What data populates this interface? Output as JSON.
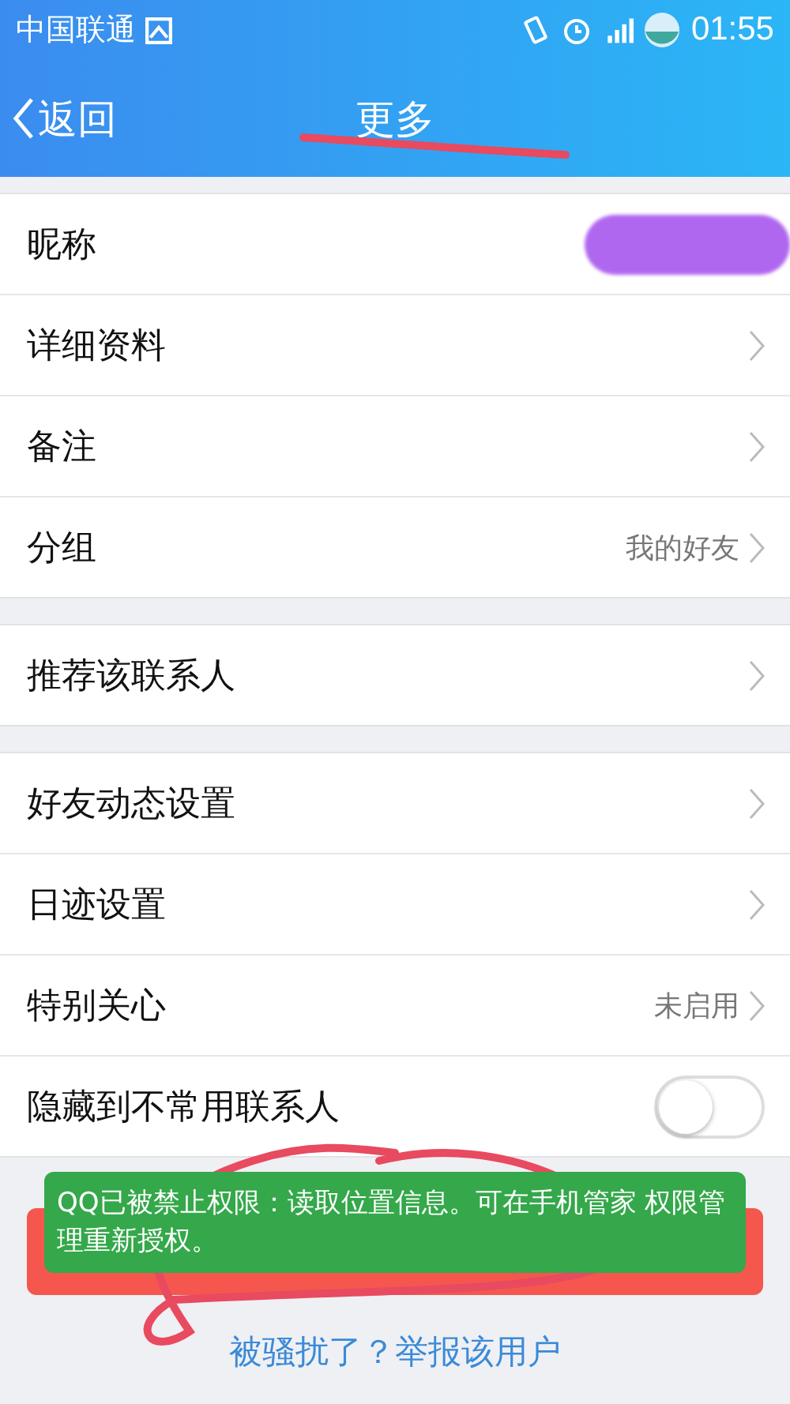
{
  "status_bar": {
    "carrier": "中国联通",
    "time": "01:55"
  },
  "nav": {
    "back": "返回",
    "title": "更多"
  },
  "sections": [
    [
      {
        "kind": "redacted",
        "label": "昵称"
      },
      {
        "kind": "link",
        "label": "详细资料"
      },
      {
        "kind": "link",
        "label": "备注"
      },
      {
        "kind": "link",
        "label": "分组",
        "value": "我的好友"
      }
    ],
    [
      {
        "kind": "link",
        "label": "推荐该联系人"
      }
    ],
    [
      {
        "kind": "link",
        "label": "好友动态设置"
      },
      {
        "kind": "link",
        "label": "日迹设置"
      },
      {
        "kind": "link",
        "label": "特别关心",
        "value": "未启用"
      },
      {
        "kind": "toggle",
        "label": "隐藏到不常用联系人",
        "on": false
      }
    ]
  ],
  "toast": "QQ已被禁止权限：读取位置信息。可在手机管家 权限管理重新授权。",
  "report_link": "被骚扰了？举报该用户"
}
